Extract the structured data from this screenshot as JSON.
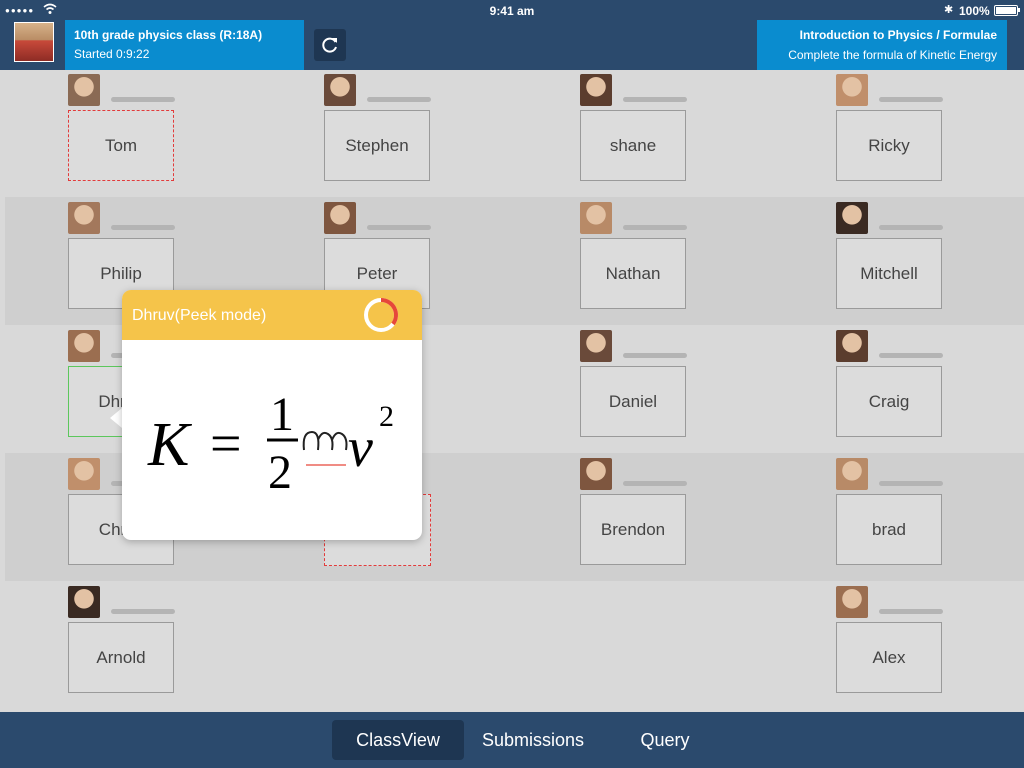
{
  "status": {
    "time": "9:41 am",
    "battery": "100%"
  },
  "header": {
    "class_title": "10th grade physics class (R:18A)",
    "started": "Started 0:9:22",
    "lesson_title": "Introduction to Physics / Formulae",
    "lesson_task": "Complete the formula of Kinetic Energy"
  },
  "students": [
    {
      "name": "Tom",
      "state": "dashed"
    },
    {
      "name": "Stephen",
      "state": "normal"
    },
    {
      "name": "shane",
      "state": "normal"
    },
    {
      "name": "Ricky",
      "state": "normal"
    },
    {
      "name": "Philip",
      "state": "normal"
    },
    {
      "name": "Peter",
      "state": "normal"
    },
    {
      "name": "Nathan",
      "state": "normal"
    },
    {
      "name": "Mitchell",
      "state": "normal"
    },
    {
      "name": "Dhruv",
      "state": "selected"
    },
    {
      "name": "",
      "state": "hidden"
    },
    {
      "name": "Daniel",
      "state": "normal"
    },
    {
      "name": "Craig",
      "state": "normal"
    },
    {
      "name": "Christ",
      "state": "normal"
    },
    {
      "name": "",
      "state": "hidden"
    },
    {
      "name": "Brendon",
      "state": "normal"
    },
    {
      "name": "brad",
      "state": "normal"
    },
    {
      "name": "Arnold",
      "state": "normal"
    },
    {
      "name": "Alex",
      "state": "normal"
    }
  ],
  "popup": {
    "title": "Dhruv(Peek mode)",
    "formula": {
      "lhs": "K",
      "eq": "=",
      "num": "1",
      "den": "2",
      "handwritten": "m",
      "var": "v",
      "exp": "2"
    }
  },
  "tabs": [
    {
      "label": "ClassView",
      "active": true
    },
    {
      "label": "Submissions",
      "active": false
    },
    {
      "label": "Query",
      "active": false
    }
  ]
}
